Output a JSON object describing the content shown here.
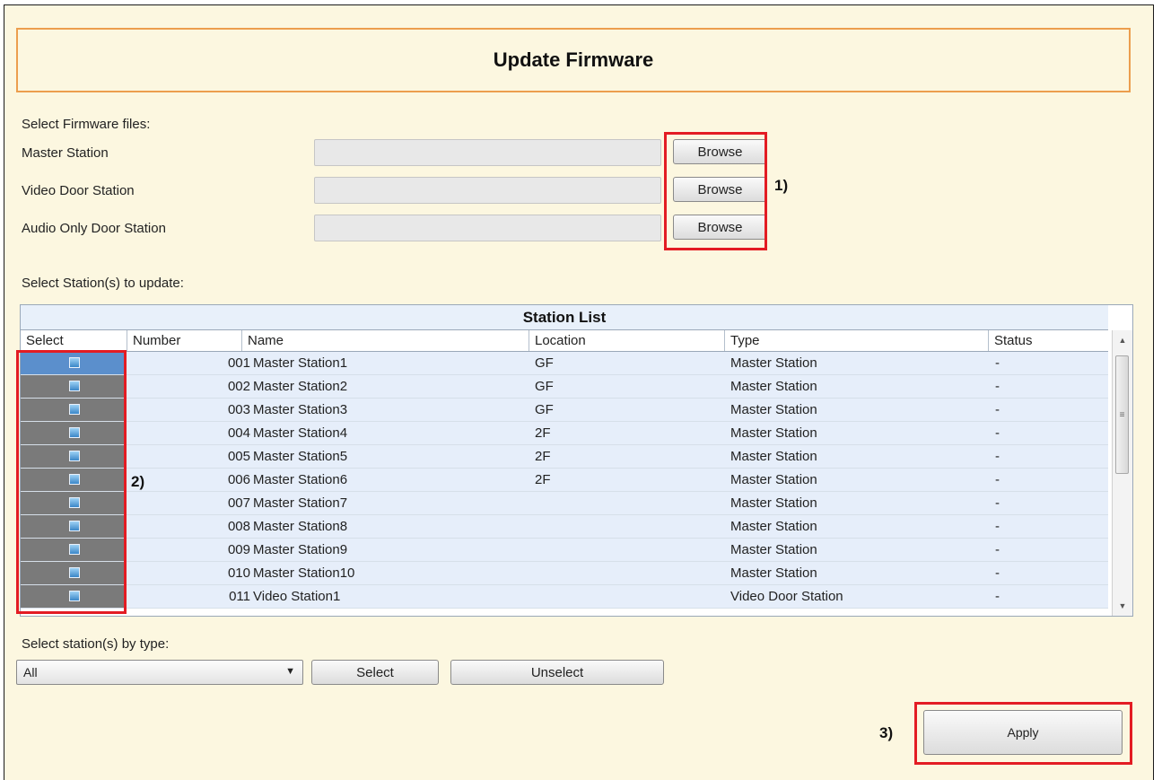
{
  "title": "Update Firmware",
  "firmware": {
    "section_label": "Select Firmware files:",
    "rows": [
      {
        "label": "Master Station",
        "value": "",
        "button": "Browse"
      },
      {
        "label": "Video Door Station",
        "value": "",
        "button": "Browse"
      },
      {
        "label": "Audio Only Door Station",
        "value": "",
        "button": "Browse"
      }
    ]
  },
  "stations": {
    "section_label": "Select Station(s) to update:",
    "table_title": "Station List",
    "columns": [
      "Select",
      "Number",
      "Name",
      "Location",
      "Type",
      "Status"
    ],
    "rows": [
      {
        "number": "001",
        "name": "Master Station1",
        "location": "GF",
        "type": "Master Station",
        "status": "-"
      },
      {
        "number": "002",
        "name": "Master Station2",
        "location": "GF",
        "type": "Master Station",
        "status": "-"
      },
      {
        "number": "003",
        "name": "Master Station3",
        "location": "GF",
        "type": "Master Station",
        "status": "-"
      },
      {
        "number": "004",
        "name": "Master Station4",
        "location": "2F",
        "type": "Master Station",
        "status": "-"
      },
      {
        "number": "005",
        "name": "Master Station5",
        "location": "2F",
        "type": "Master Station",
        "status": "-"
      },
      {
        "number": "006",
        "name": "Master Station6",
        "location": "2F",
        "type": "Master Station",
        "status": "-"
      },
      {
        "number": "007",
        "name": "Master Station7",
        "location": "",
        "type": "Master Station",
        "status": "-"
      },
      {
        "number": "008",
        "name": "Master Station8",
        "location": "",
        "type": "Master Station",
        "status": "-"
      },
      {
        "number": "009",
        "name": "Master Station9",
        "location": "",
        "type": "Master Station",
        "status": "-"
      },
      {
        "number": "010",
        "name": "Master Station10",
        "location": "",
        "type": "Master Station",
        "status": "-"
      },
      {
        "number": "011",
        "name": "Video Station1",
        "location": "",
        "type": "Video Door Station",
        "status": "-"
      }
    ]
  },
  "by_type": {
    "label": "Select station(s) by type:",
    "selected": "All",
    "select_button": "Select",
    "unselect_button": "Unselect"
  },
  "apply_button": "Apply",
  "callouts": [
    "1)",
    "2)",
    "3)"
  ],
  "colors": {
    "accent_border": "#ec9e4e",
    "highlight": "#e31c23",
    "background": "#fcf7e0"
  }
}
